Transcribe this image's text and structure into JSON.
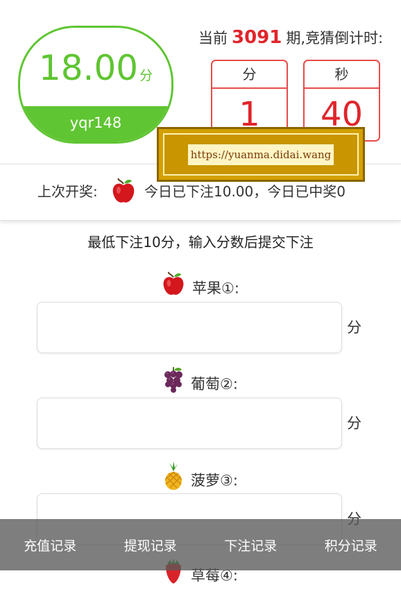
{
  "score": {
    "value": "18.00",
    "unit": "分",
    "username": "yqr148"
  },
  "period": {
    "prefix": "当前",
    "number": "3091",
    "suffix": "期,竞猜倒计时:"
  },
  "countdown": {
    "minutes_label": "分",
    "minutes_value": "1",
    "seconds_label": "秒",
    "seconds_value": "40"
  },
  "watermark": {
    "text": "https://yuanma.didai.wang"
  },
  "last_draw": {
    "label": "上次开奖:",
    "fruit_icon": "apple-icon",
    "summary": "今日已下注10.00，今日已中奖0"
  },
  "form": {
    "hint": "最低下注10分，输入分数后提交下注",
    "unit": "分",
    "options": [
      {
        "label": "苹果①:",
        "icon": "apple-icon",
        "value": ""
      },
      {
        "label": "葡萄②:",
        "icon": "grape-icon",
        "value": ""
      },
      {
        "label": "菠萝③:",
        "icon": "pineapple-icon",
        "value": ""
      },
      {
        "label": "草莓④:",
        "icon": "strawberry-icon",
        "value": ""
      }
    ]
  },
  "nav": {
    "items": [
      "充值记录",
      "提现记录",
      "下注记录",
      "积分记录"
    ]
  },
  "colors": {
    "green": "#5fc532",
    "red": "#e0242b",
    "nav_bg": "#5a5a5a"
  }
}
